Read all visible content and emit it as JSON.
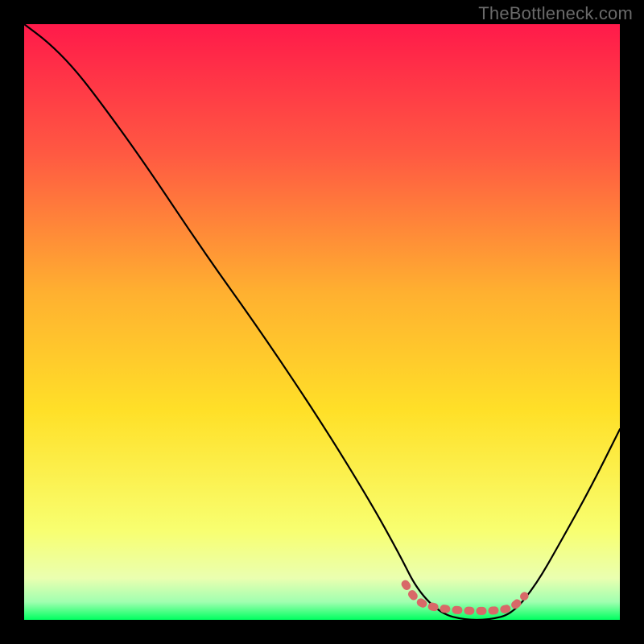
{
  "watermark": "TheBottleneck.com",
  "chart_data": {
    "type": "line",
    "xlabel": "",
    "ylabel": "",
    "xlim": [
      0,
      100
    ],
    "ylim": [
      0,
      100
    ],
    "grid": false,
    "legend": false,
    "background_gradient": {
      "top": "#ff1a4a",
      "mid_upper": "#ff7040",
      "mid": "#ffd830",
      "mid_lower": "#f8ff70",
      "bottom": "#00ff60"
    },
    "series": [
      {
        "name": "curve",
        "color": "#000000",
        "points": [
          {
            "x": 0,
            "y": 100
          },
          {
            "x": 4,
            "y": 97
          },
          {
            "x": 8,
            "y": 93
          },
          {
            "x": 12,
            "y": 88
          },
          {
            "x": 20,
            "y": 77
          },
          {
            "x": 30,
            "y": 62
          },
          {
            "x": 40,
            "y": 48
          },
          {
            "x": 50,
            "y": 33
          },
          {
            "x": 58,
            "y": 20
          },
          {
            "x": 63,
            "y": 11
          },
          {
            "x": 66,
            "y": 5
          },
          {
            "x": 70,
            "y": 1
          },
          {
            "x": 74,
            "y": 0
          },
          {
            "x": 78,
            "y": 0
          },
          {
            "x": 82,
            "y": 1
          },
          {
            "x": 86,
            "y": 6
          },
          {
            "x": 90,
            "y": 13
          },
          {
            "x": 95,
            "y": 22
          },
          {
            "x": 100,
            "y": 32
          }
        ]
      },
      {
        "name": "bottom-marker",
        "color": "#e07070",
        "style": "dashed-thick",
        "points": [
          {
            "x": 64,
            "y": 6
          },
          {
            "x": 66,
            "y": 3
          },
          {
            "x": 69,
            "y": 2
          },
          {
            "x": 74,
            "y": 1.5
          },
          {
            "x": 79,
            "y": 1.5
          },
          {
            "x": 82,
            "y": 2
          },
          {
            "x": 84,
            "y": 4
          }
        ]
      }
    ]
  }
}
